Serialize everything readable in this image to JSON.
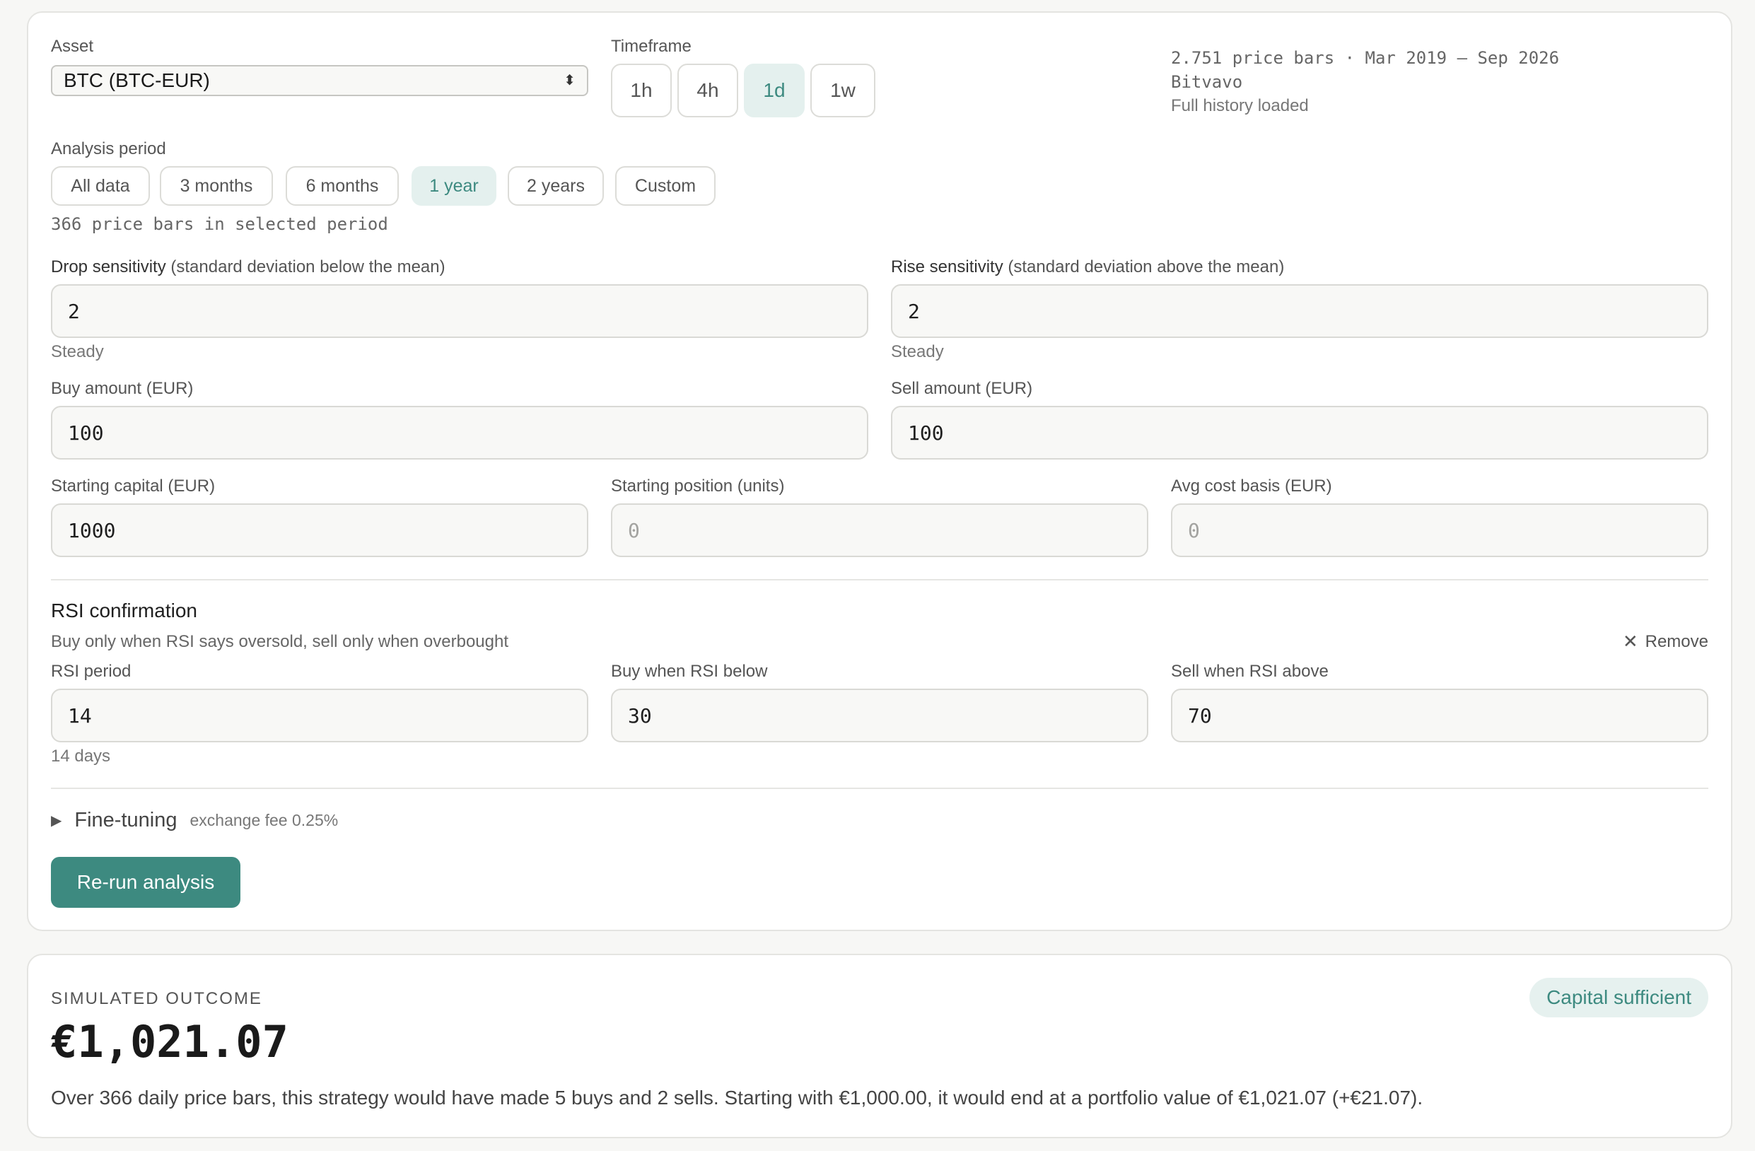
{
  "config": {
    "asset": {
      "label": "Asset",
      "selected": "BTC (BTC-EUR)"
    },
    "timeframe": {
      "label": "Timeframe",
      "options": [
        "1h",
        "4h",
        "1d",
        "1w"
      ],
      "active": "1d"
    },
    "dataset_info": {
      "bars_range": "2.751 price bars · Mar 2019 — Sep 2026",
      "exchange": "Bitvavo",
      "status": "Full history loaded"
    },
    "analysis_period": {
      "label": "Analysis period",
      "options": [
        "All data",
        "3 months",
        "6 months",
        "1 year",
        "2 years",
        "Custom"
      ],
      "active": "1 year",
      "summary": "366 price bars in selected period"
    },
    "drop_sensitivity": {
      "label": "Drop sensitivity",
      "qualifier": "(standard deviation below the mean)",
      "value": "2",
      "hint": "Steady"
    },
    "rise_sensitivity": {
      "label": "Rise sensitivity",
      "qualifier": "(standard deviation above the mean)",
      "value": "2",
      "hint": "Steady"
    },
    "buy_amount": {
      "label": "Buy amount (EUR)",
      "value": "100"
    },
    "sell_amount": {
      "label": "Sell amount (EUR)",
      "value": "100"
    },
    "starting_capital": {
      "label": "Starting capital (EUR)",
      "value": "1000"
    },
    "starting_position": {
      "label": "Starting position (units)",
      "value": "",
      "placeholder": "0"
    },
    "avg_cost_basis": {
      "label": "Avg cost basis (EUR)",
      "value": "",
      "placeholder": "0"
    },
    "rsi": {
      "title": "RSI confirmation",
      "description": "Buy only when RSI says oversold, sell only when overbought",
      "remove_label": "Remove",
      "period": {
        "label": "RSI period",
        "value": "14",
        "hint": "14 days"
      },
      "buy_below": {
        "label": "Buy when RSI below",
        "value": "30"
      },
      "sell_above": {
        "label": "Sell when RSI above",
        "value": "70"
      }
    },
    "fine_tuning": {
      "label": "Fine-tuning",
      "summary": "exchange fee 0.25%"
    },
    "run_button": "Re-run analysis"
  },
  "outcome": {
    "heading": "SIMULATED OUTCOME",
    "value": "€1,021.07",
    "badge": "Capital sufficient",
    "summary": "Over 366 daily price bars, this strategy would have made 5 buys and 2 sells. Starting with €1,000.00, it would end at a portfolio value of €1,021.07 (+€21.07)."
  },
  "colors": {
    "accent": "#3d8a80",
    "accent_soft": "#e4f0ee",
    "background": "#f7f7f5"
  }
}
